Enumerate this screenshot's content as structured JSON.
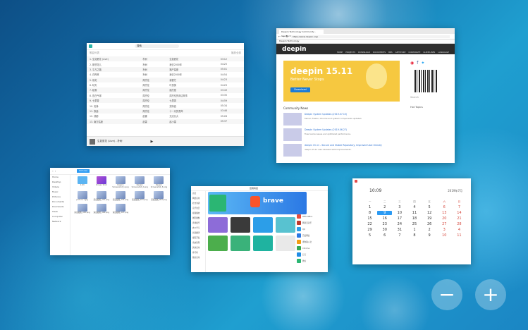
{
  "workspace": {
    "add_label": "+",
    "remove_label": "−"
  },
  "music": {
    "search_placeholder": "搜索",
    "header_left": "歌曲列表",
    "header_right": "播放全部",
    "rows": [
      [
        "1. 生如夏花 (Live)",
        "朴树",
        "生如夏花",
        "03:12"
      ],
      [
        "2. 那些花儿",
        "朴树",
        "我去2000年",
        "04:25"
      ],
      [
        "3. 平凡之路",
        "朴树",
        "猎户星座",
        "05:01"
      ],
      [
        "4. 白桦林",
        "朴树",
        "我去2000年",
        "04:54"
      ],
      [
        "5. 彩虹",
        "周杰伦",
        "我很忙",
        "04:23"
      ],
      [
        "6. 晴天",
        "周杰伦",
        "叶惠美",
        "04:29"
      ],
      [
        "7. 稻香",
        "周杰伦",
        "魔杰座",
        "03:43"
      ],
      [
        "8. 告白气球",
        "周杰伦",
        "周杰伦的床边故事",
        "03:35"
      ],
      [
        "9. 七里香",
        "周杰伦",
        "七里香",
        "04:59"
      ],
      [
        "10. 安静",
        "周杰伦",
        "范特西",
        "05:34"
      ],
      [
        "11. 夜曲",
        "周杰伦",
        "十一月的萧邦",
        "03:46"
      ],
      [
        "12. 成都",
        "赵雷",
        "无法长大",
        "05:28"
      ],
      [
        "13. 南方姑娘",
        "赵雷",
        "赵小雷",
        "05:37"
      ]
    ],
    "now_playing": "生如夏花 (Live) - 朴树"
  },
  "browser": {
    "tab_title": "Deepin Technology Community - Google Chrome",
    "url": "https://www.deepin.org/",
    "bookmark": "Deepin Technology",
    "nav_logo": "deepin",
    "nav_items": [
      "HOME",
      "PROJECTS",
      "DOWNLOAD",
      "DOCUMENTS",
      "BBS",
      "APPSTORE",
      "CORPORATE",
      "GUIDELINES",
      "LANGUAGE"
    ],
    "banner_title": "deepin 15.11",
    "banner_subtitle": "Better Never Stops",
    "banner_button": "Download",
    "news_heading": "Community News",
    "news": [
      {
        "title": "Deepin System Updates (2019.07.15)",
        "desc": "Kernel, Firefox, Chrome and system components updated."
      },
      {
        "title": "Deepin System Updates (2019.06.27)",
        "desc": "Fixed some issues and optimized performance."
      },
      {
        "title": "deepin 15.11 - Secure and Stable Repository, Improved User-friendly",
        "desc": "deepin 15.11 was released with improvements."
      }
    ],
    "hot_topics_heading": "Hot Topics",
    "search_label": "Search"
  },
  "files": {
    "crumb": "Pictures",
    "sidebar": [
      "Home",
      "Desktop",
      "Videos",
      "Music",
      "Pictures",
      "Documents",
      "Downloads",
      "Trash",
      "Computer",
      "Network"
    ],
    "items": [
      "1.txt",
      "Screen Shot",
      "Deepin Screenshot_1.png",
      "Deepin Screenshot_2.png",
      "Deepin Screenshot_3.png",
      "picture-1.jpg",
      "深度截图_001.png",
      "深度截图_002.png",
      "深度截图_003.png",
      "深度截图_004.png",
      "深度截图_005.png",
      "深度截图_006.png",
      "深度截图_007.png"
    ]
  },
  "store": {
    "title": "应用商店",
    "sidebar": [
      "首页",
      "网络应用",
      "社交沟通",
      "音乐欣赏",
      "视频播放",
      "图形图像",
      "游戏娱乐",
      "办公学习",
      "阅读翻译",
      "编程开发",
      "系统管理",
      "其他应用",
      "排行榜",
      "我的应用"
    ],
    "hero_title": "brave",
    "list": [
      "WPS Office",
      "网易云音乐",
      "QQ",
      "百度网盘",
      "搜狗输入法",
      "Chrome",
      "钉钉",
      "微信"
    ]
  },
  "calendar": {
    "time": "10:09",
    "month_label": "2019年7月",
    "weekdays": [
      "一",
      "二",
      "三",
      "四",
      "五",
      "六",
      "日"
    ],
    "days": [
      [
        "1",
        "2",
        "3",
        "4",
        "5",
        "6",
        "7"
      ],
      [
        "8",
        "9",
        "10",
        "11",
        "12",
        "13",
        "14"
      ],
      [
        "15",
        "16",
        "17",
        "18",
        "19",
        "20",
        "21"
      ],
      [
        "22",
        "23",
        "24",
        "25",
        "26",
        "27",
        "28"
      ],
      [
        "29",
        "30",
        "31",
        "1",
        "2",
        "3",
        "4"
      ],
      [
        "5",
        "6",
        "7",
        "8",
        "9",
        "10",
        "11"
      ]
    ]
  }
}
